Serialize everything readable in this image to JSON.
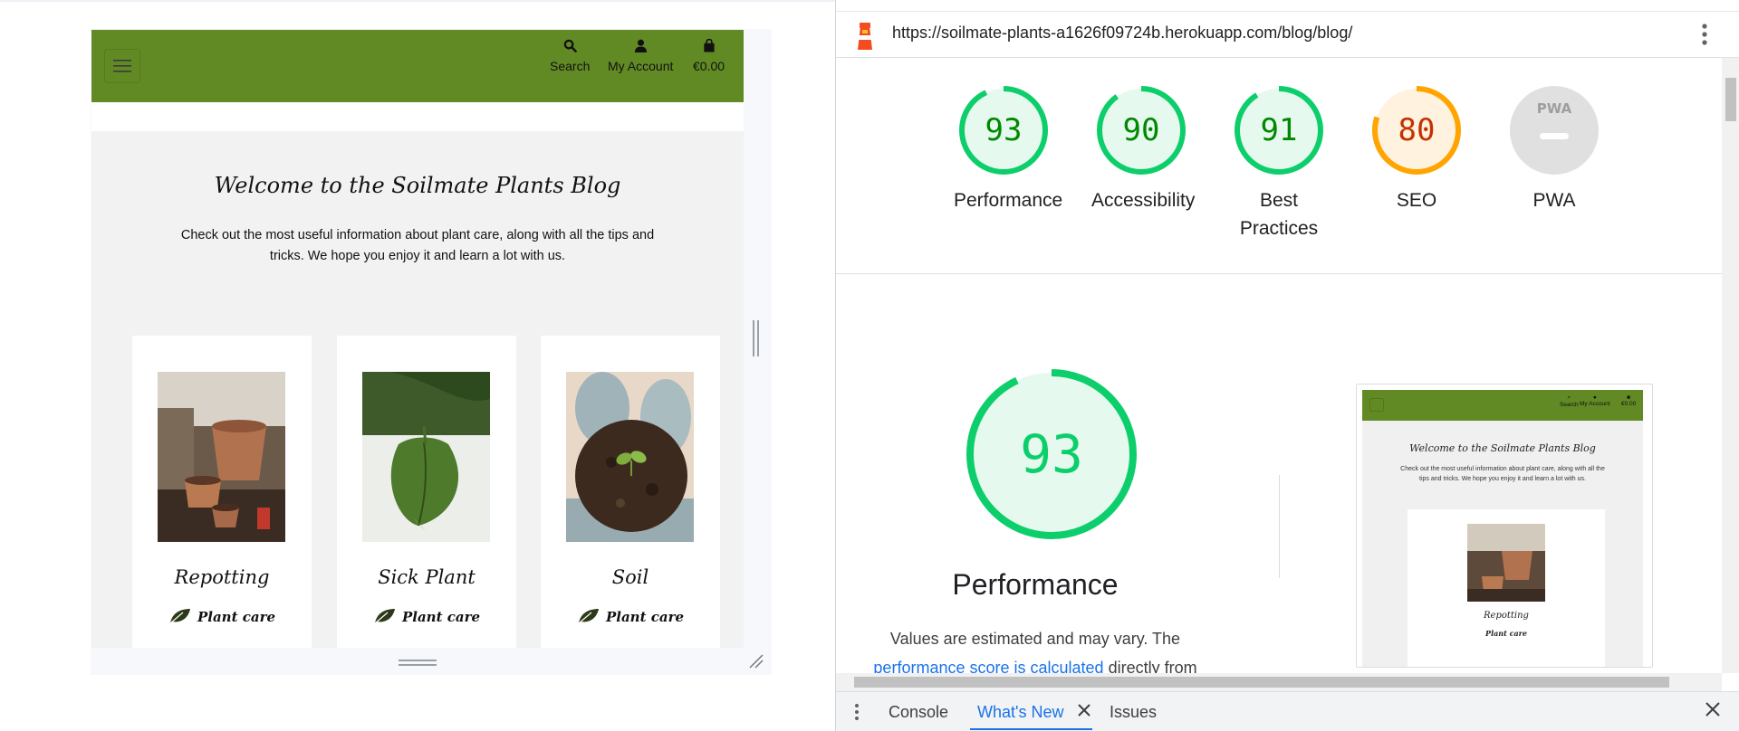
{
  "preview": {
    "nav": {
      "search_label": "Search",
      "account_label": "My Account",
      "bag_label": "€0.00"
    },
    "blog_title": "Welcome to the Soilmate Plants Blog",
    "blog_subtitle": "Check out the most useful information about plant care, along with all the tips and tricks. We hope you enjoy it and learn a lot with us.",
    "cards": [
      {
        "title": "Repotting",
        "category": "Plant care"
      },
      {
        "title": "Sick Plant",
        "category": "Plant care"
      },
      {
        "title": "Soil",
        "category": "Plant care"
      }
    ],
    "brand_color": "#628a24"
  },
  "devtools": {
    "url": "https://soilmate-plants-a1626f09724b.herokuapp.com/blog/blog/",
    "scores": [
      {
        "label": "Performance",
        "value": "93",
        "score": 93,
        "status": "pass"
      },
      {
        "label": "Accessibility",
        "value": "90",
        "score": 90,
        "status": "pass"
      },
      {
        "label": "Best Practices",
        "value": "91",
        "score": 91,
        "status": "pass"
      },
      {
        "label": "SEO",
        "value": "80",
        "score": 80,
        "status": "average"
      },
      {
        "label": "PWA",
        "value": "PWA",
        "score": null,
        "status": "na"
      }
    ],
    "focus": {
      "value": "93",
      "score": 93,
      "title": "Performance",
      "desc_prefix": "Values are estimated and may vary. The",
      "desc_link": "performance score is calculated",
      "desc_suffix": "directly from these"
    },
    "thumbnail": {
      "title": "Welcome to the Soilmate Plants Blog",
      "subtitle": "Check out the most useful information about plant care, along with all the tips and tricks. We hope you enjoy it and learn a lot with us.",
      "card_title": "Repotting",
      "card_category": "Plant care",
      "nav_search": "Search",
      "nav_account": "My Account",
      "nav_bag": "€0.00"
    },
    "drawer": {
      "tabs": [
        "Console",
        "What's New",
        "Issues"
      ],
      "active_tab": "What's New"
    },
    "colors": {
      "pass": "#0cce6b",
      "pass_text": "#008800",
      "average": "#ffa400",
      "average_text": "#c33300",
      "na": "#e0e0e0"
    }
  }
}
